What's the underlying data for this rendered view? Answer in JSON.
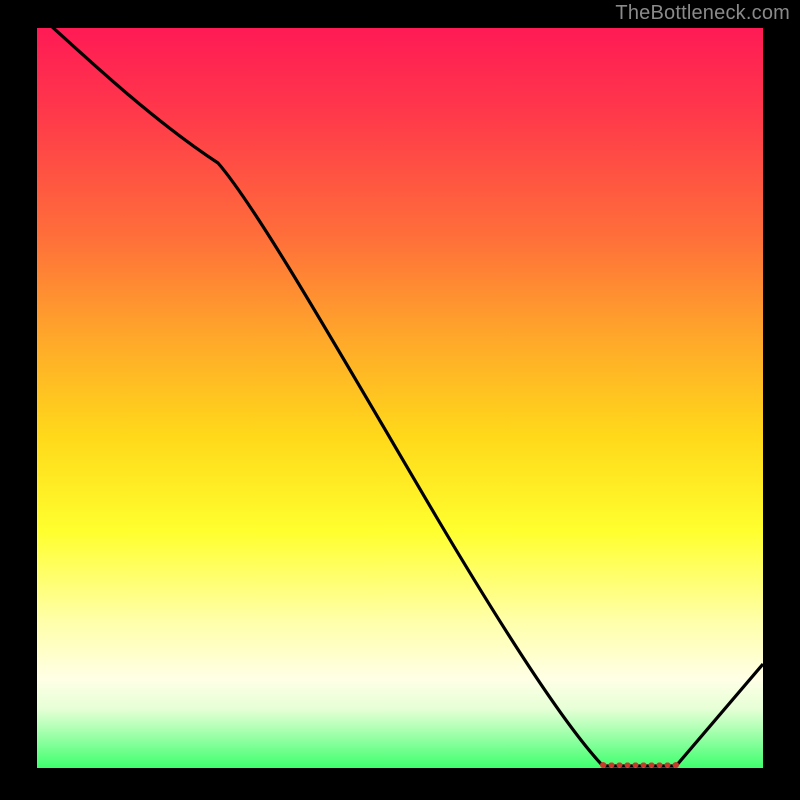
{
  "source_watermark": "TheBottleneck.com",
  "chart_data": {
    "type": "line",
    "title": "",
    "xlabel": "",
    "ylabel": "",
    "xlim": [
      0,
      100
    ],
    "ylim": [
      0,
      100
    ],
    "x": [
      0,
      25,
      78,
      88,
      100
    ],
    "y": [
      102,
      82,
      0,
      0,
      14
    ],
    "background_gradient_stops": [
      {
        "pct": 0,
        "color": "#ff1a55"
      },
      {
        "pct": 12,
        "color": "#ff3a4a"
      },
      {
        "pct": 28,
        "color": "#ff6e3a"
      },
      {
        "pct": 42,
        "color": "#ffa82a"
      },
      {
        "pct": 55,
        "color": "#ffd81a"
      },
      {
        "pct": 68,
        "color": "#ffff2e"
      },
      {
        "pct": 80,
        "color": "#ffffa8"
      },
      {
        "pct": 88,
        "color": "#ffffe6"
      },
      {
        "pct": 92,
        "color": "#e6ffd6"
      },
      {
        "pct": 95,
        "color": "#a8ffb0"
      },
      {
        "pct": 100,
        "color": "#3eff6e"
      }
    ],
    "dotted_segment": {
      "x": [
        78,
        88
      ],
      "y": [
        0,
        0
      ],
      "color": "#d04030"
    }
  }
}
